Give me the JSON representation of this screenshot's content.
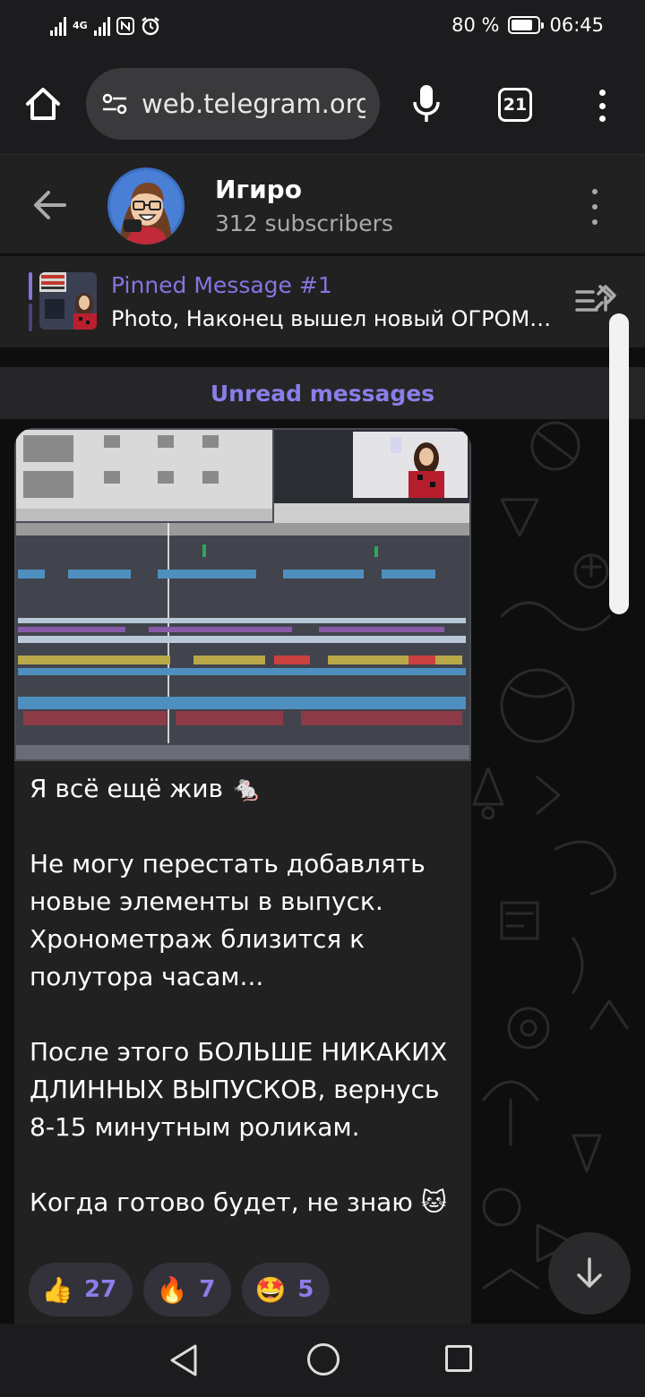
{
  "status_bar": {
    "network": "4G",
    "battery": "80 %",
    "battery_level": 0.8,
    "time": "06:45"
  },
  "browser": {
    "url": "web.telegram.org",
    "tab_count": "21"
  },
  "channel": {
    "title": "Игиро",
    "subscribers": "312 subscribers"
  },
  "pinned": {
    "title": "Pinned Message #1",
    "preview": "Photo, Наконец вышел новый ОГРОМНЫЙ выпуск"
  },
  "chat": {
    "unread_label": "Unread messages",
    "message": {
      "text": "Я всё ещё жив 🐁\n\nНе могу перестать добавлять новые элементы в выпуск. Хронометраж близится к полутора часам...\n\nПосле этого БОЛЬШЕ НИКАКИХ ДЛИННЫХ ВЫПУСКОВ, вернусь 8-15 минутным роликам.\n\nКогда готово будет, не знаю 🐱",
      "reactions": [
        {
          "emoji": "👍",
          "count": "27"
        },
        {
          "emoji": "🔥",
          "count": "7"
        },
        {
          "emoji": "🤩",
          "count": "5"
        }
      ]
    }
  },
  "colors": {
    "accent": "#8774e1",
    "header_bg": "#212121",
    "bubble_bg": "#212121"
  }
}
